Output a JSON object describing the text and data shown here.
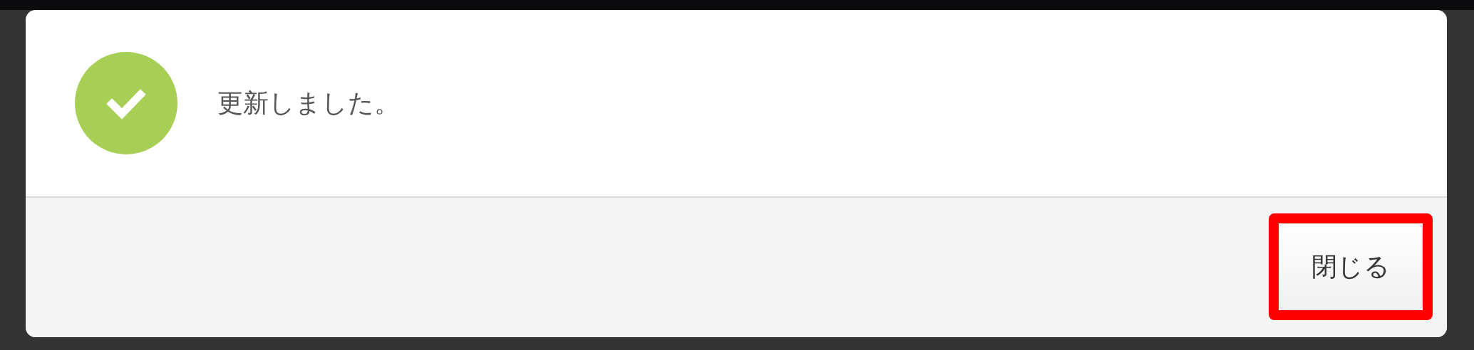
{
  "dialog": {
    "icon": {
      "kind": "success"
    },
    "message": "更新しました。",
    "buttons": [
      {
        "label": "閉じる",
        "highlighted": true
      }
    ]
  }
}
